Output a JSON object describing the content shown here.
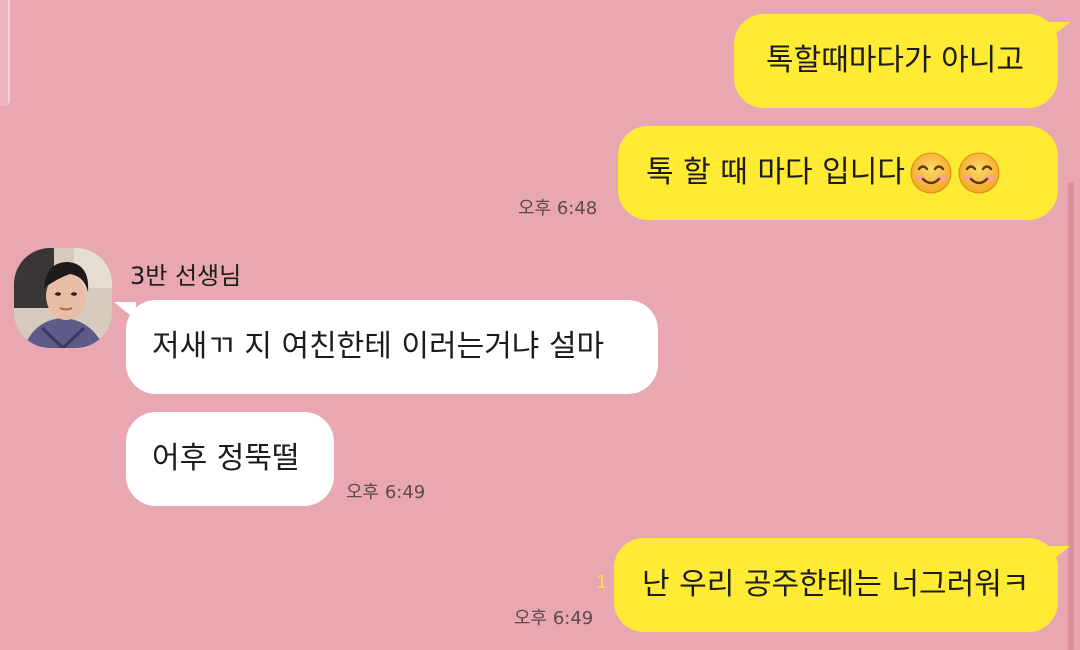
{
  "messages": [
    {
      "text": "톡할때마다가 아니고"
    },
    {
      "text": "톡 할 때 마다 입니다",
      "emoji": [
        "smiling-face-icon",
        "smiling-face-icon"
      ],
      "time": "오후 6:48"
    },
    {
      "sender": "3반 선생님",
      "text": "저새ㄲ 지 여친한테 이러는거냐 설마"
    },
    {
      "text": "어후 정뚝떨",
      "time": "오후 6:49"
    },
    {
      "text": "난 우리 공주한테는 너그러워ㅋ",
      "unread": "1",
      "time": "오후 6:49"
    }
  ],
  "colors": {
    "background": "#e9a7b2",
    "my_bubble": "#ffeb33",
    "their_bubble": "#ffffff"
  }
}
